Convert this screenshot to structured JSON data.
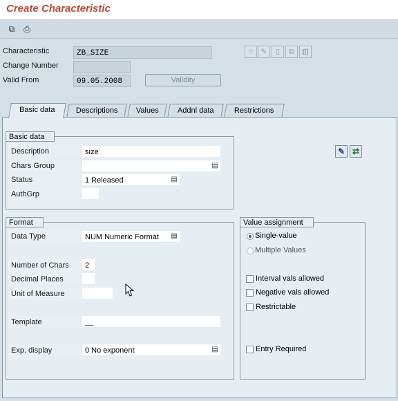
{
  "app": {
    "title": "Create Characteristic"
  },
  "toolbar": {
    "icons": [
      "other-object-icon",
      "print-icon"
    ]
  },
  "header": {
    "characteristic_label": "Characteristic",
    "characteristic_value": "ZB_SIZE",
    "change_number_label": "Change Number",
    "change_number_value": "",
    "valid_from_label": "Valid From",
    "valid_from_value": "09.05.2008",
    "validity_button": "Validity",
    "side_icons": [
      "display-icon",
      "edit-pencil-icon",
      "new-document-icon",
      "copy-icon",
      "delete-icon"
    ]
  },
  "tabs": [
    "Basic data",
    "Descriptions",
    "Values",
    "Addnl data",
    "Restrictions"
  ],
  "active_tab": "Basic data",
  "basic_data": {
    "group_title": "Basic data",
    "description_label": "Description",
    "description_value": "size",
    "chars_group_label": "Chars Group",
    "chars_group_value": "",
    "status_label": "Status",
    "status_value": "1 Released",
    "authgrp_label": "AuthGrp",
    "authgrp_value": ""
  },
  "format": {
    "group_title": "Format",
    "data_type_label": "Data Type",
    "data_type_value": "NUM Numeric Format",
    "num_chars_label": "Number of Chars",
    "num_chars_value": "2",
    "decimal_places_label": "Decimal Places",
    "decimal_places_value": "",
    "uom_label": "Unit of Measure",
    "uom_value": "",
    "template_label": "Template",
    "template_value": "__",
    "exp_display_label": "Exp. display",
    "exp_display_value": "0 No exponent"
  },
  "value_assignment": {
    "group_title": "Value assignment",
    "single_value": "Single-value",
    "single_selected": true,
    "multiple_values": "Multiple Values",
    "interval_vals": "Interval vals allowed",
    "negative_vals": "Negative vals allowed",
    "restrictable": "Restrictable",
    "entry_required": "Entry Required"
  },
  "colors": {
    "title": "#b44a3a",
    "background": "#d5dfe6",
    "panel": "#e6eef3"
  }
}
